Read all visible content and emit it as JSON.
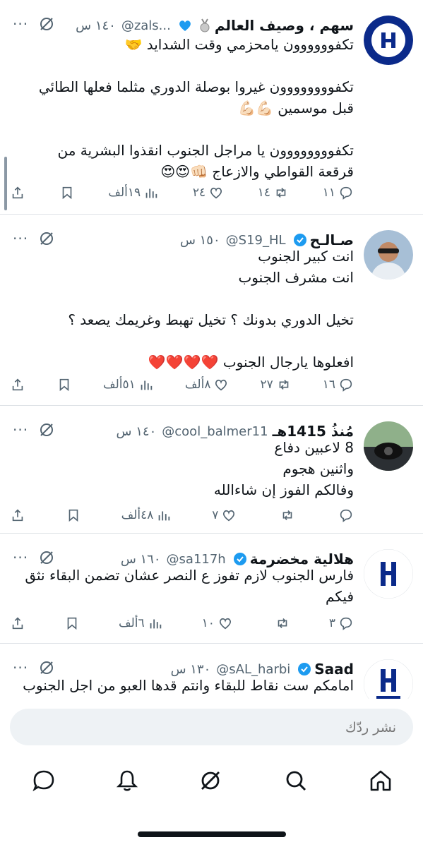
{
  "tweets": [
    {
      "name": "سهم ، وصيف العالم",
      "handle": "@zals...",
      "time": "١٤٠ س",
      "lines": [
        "تكفوووووون يامحزمي وقت الشدايد 🤝",
        "",
        "تكفوووووووون غيروا بوصلة الدوري مثلما فعلها الطائي",
        "قبل موسمين 💪🏻💪🏻",
        "",
        "تكفوووووووون يا مراجل الجنوب انقذوا البشرية من",
        "قرقعة القواطي والازعاج 👊🏻😍😍"
      ],
      "replies": "١١",
      "retweets": "١٤",
      "likes": "٢٤",
      "views": "١٩ألف"
    },
    {
      "name": "صـالـح",
      "handle": "@S19_HL",
      "time": "١٥٠ س",
      "lines": [
        "انت كبير الجنوب",
        "انت مشرف الجنوب",
        "",
        "تخيل الدوري بدونك ؟ تخيل تهبط وغريمك يصعد ؟",
        "",
        "افعلوها يارجال الجنوب ❤️❤️❤️❤️"
      ],
      "replies": "١٦",
      "retweets": "٢٧",
      "likes": "٨ألف",
      "views": "٥١ألف"
    },
    {
      "name": "مُنذُ 1415هـ",
      "handle": "@cool_balmer11",
      "time": "١٤٠ س",
      "lines": [
        "8 لاعبين دفاع",
        "واثنين هجوم",
        "وفالكم الفوز إن شاءالله"
      ],
      "replies": "",
      "retweets": "",
      "likes": "٧",
      "views": "٤٨ألف"
    },
    {
      "name": "هلالية مخضرمة",
      "handle": "@sa117h",
      "time": "١٦٠ س",
      "lines": [
        "فارس الجنوب لازم تفوز ع النصر عشان تضمن البقاء نثق",
        "فيكم"
      ],
      "replies": "٣",
      "retweets": "",
      "likes": "١٠",
      "views": "٦ألف"
    },
    {
      "name": "Saad",
      "handle": "@sAL_harbi",
      "time": "١٣٠ س",
      "lines": [
        "امامكم ست نقاط للبقاء وانتم قدها العبو من اجل الجنوب"
      ],
      "replies": "",
      "retweets": "",
      "likes": "",
      "views": ""
    }
  ],
  "composer": {
    "placeholder": "نشر ردّك"
  },
  "colors": {
    "accent": "#1d9bf0",
    "hilal_blue": "#0b2a8a",
    "muted": "#536471"
  }
}
